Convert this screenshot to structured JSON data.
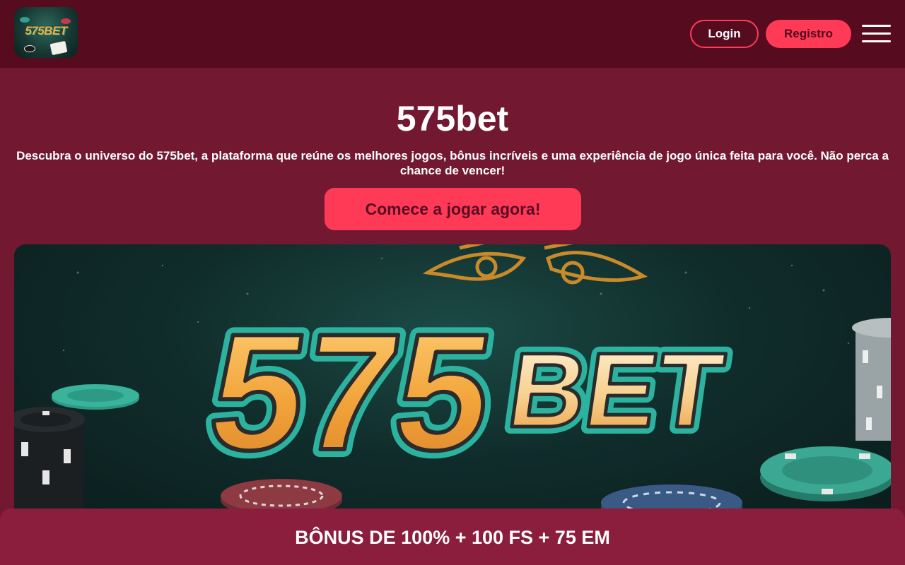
{
  "header": {
    "logo_text": "575BET",
    "login_label": "Login",
    "register_label": "Registro"
  },
  "hero": {
    "title": "575bet",
    "description": "Descubra o universo do 575bet, a plataforma que reúne os melhores jogos, bônus incríveis e uma experiência de jogo única feita para você. Não perca a chance de vencer!",
    "cta_label": "Comece a jogar agora!"
  },
  "banner": {
    "brand_text": "575BET",
    "icons": [
      "eye-icon",
      "poker-chip-icon",
      "playing-card-icon"
    ]
  },
  "bonus": {
    "text": "BÔNUS DE 100% + 100 FS + 75 EM"
  },
  "colors": {
    "header_bg": "#560b1f",
    "page_bg": "#721931",
    "accent": "#ff3a56",
    "bonus_bg": "#8b1e3c",
    "brand_gold": "#f2a43a",
    "brand_teal": "#2bb3a0"
  }
}
